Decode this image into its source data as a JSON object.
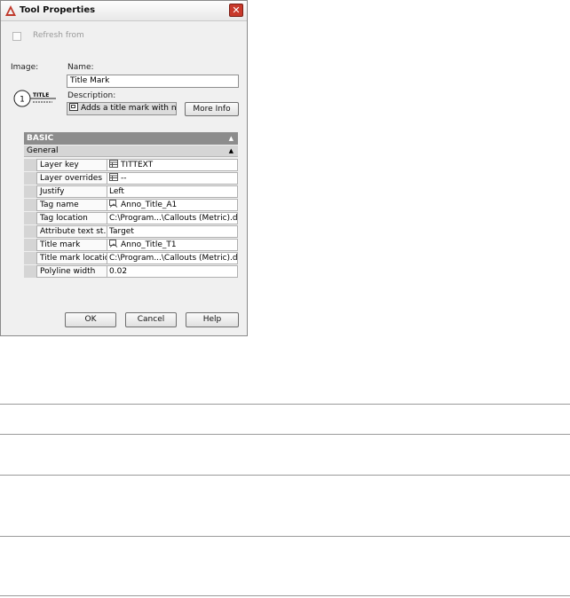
{
  "window": {
    "title": "Tool Properties",
    "close_symbol": "✕"
  },
  "refresh": {
    "label": "Refresh from",
    "checked": false
  },
  "labels": {
    "image": "Image:",
    "name": "Name:",
    "description": "Description:"
  },
  "fields": {
    "name_value": "Title Mark",
    "description_value": "Adds a title mark with n..."
  },
  "preview": {
    "number": "1",
    "title": "TITLE"
  },
  "buttons": {
    "more_info": "More Info",
    "ok": "OK",
    "cancel": "Cancel",
    "help": "Help"
  },
  "grid": {
    "category": "BASIC",
    "subcategory": "General",
    "collapse_symbol": "▲",
    "rows": [
      {
        "key": "Layer key",
        "value": "TITTEXT",
        "icon": "layer-icon"
      },
      {
        "key": "Layer overrides",
        "value": "--",
        "icon": "layer-icon"
      },
      {
        "key": "Justify",
        "value": "Left",
        "icon": ""
      },
      {
        "key": "Tag name",
        "value": "Anno_Title_A1",
        "icon": "block-icon"
      },
      {
        "key": "Tag location",
        "value": "C:\\Program...\\Callouts (Metric).dwg",
        "icon": ""
      },
      {
        "key": "Attribute text st...",
        "value": "Target",
        "icon": ""
      },
      {
        "key": "Title mark",
        "value": "Anno_Title_T1",
        "icon": "block-icon"
      },
      {
        "key": "Title mark location",
        "value": "C:\\Program...\\Callouts (Metric).dwg",
        "icon": ""
      },
      {
        "key": "Polyline width",
        "value": "0.02",
        "icon": ""
      }
    ]
  }
}
